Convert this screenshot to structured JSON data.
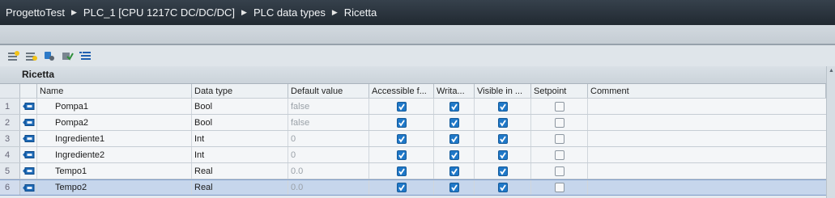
{
  "breadcrumb": [
    "ProgettoTest",
    "PLC_1 [CPU 1217C DC/DC/DC]",
    "PLC data types",
    "Ricetta"
  ],
  "toolbar": {
    "icons": [
      "insert-row-icon",
      "add-row-icon",
      "go-online-icon",
      "monitor-icon",
      "expand-all-icon"
    ]
  },
  "block_title": "Ricetta",
  "columns": {
    "name": "Name",
    "data_type": "Data type",
    "default_value": "Default value",
    "accessible": "Accessible f...",
    "writable": "Writa...",
    "visible": "Visible in ...",
    "setpoint": "Setpoint",
    "comment": "Comment"
  },
  "rows": [
    {
      "num": "1",
      "name": "Pompa1",
      "type": "Bool",
      "default": "false",
      "accessible": true,
      "writable": true,
      "visible": true,
      "setpoint": false,
      "comment": ""
    },
    {
      "num": "2",
      "name": "Pompa2",
      "type": "Bool",
      "default": "false",
      "accessible": true,
      "writable": true,
      "visible": true,
      "setpoint": false,
      "comment": ""
    },
    {
      "num": "3",
      "name": "Ingrediente1",
      "type": "Int",
      "default": "0",
      "accessible": true,
      "writable": true,
      "visible": true,
      "setpoint": false,
      "comment": ""
    },
    {
      "num": "4",
      "name": "Ingrediente2",
      "type": "Int",
      "default": "0",
      "accessible": true,
      "writable": true,
      "visible": true,
      "setpoint": false,
      "comment": ""
    },
    {
      "num": "5",
      "name": "Tempo1",
      "type": "Real",
      "default": "0.0",
      "accessible": true,
      "writable": true,
      "visible": true,
      "setpoint": false,
      "comment": ""
    },
    {
      "num": "6",
      "name": "Tempo2",
      "type": "Real",
      "default": "0.0",
      "accessible": true,
      "writable": true,
      "visible": true,
      "setpoint": false,
      "comment": "",
      "selected": true
    }
  ],
  "colors": {
    "titlebar": "#2b333c",
    "checkbox_on": "#1f78c8",
    "selected_row": "#c6d6ec"
  }
}
